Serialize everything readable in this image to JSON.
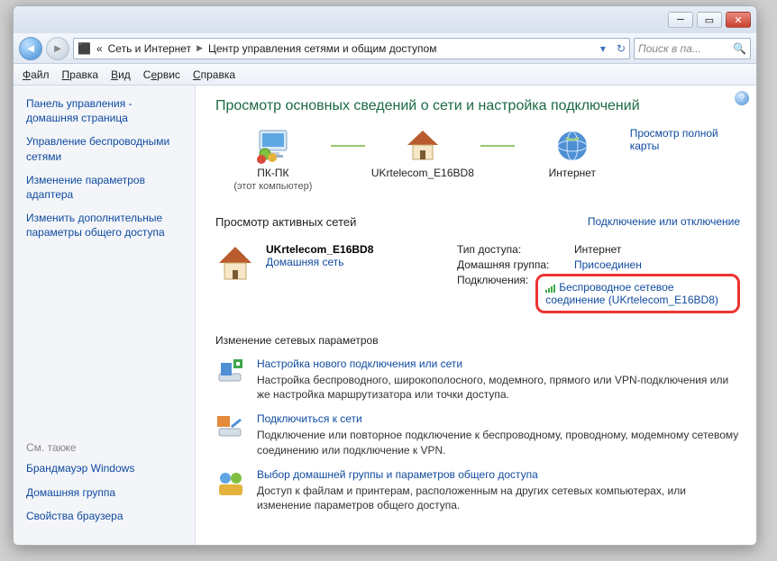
{
  "titlebar": {
    "min": "─",
    "max": "▭",
    "close": "✕"
  },
  "nav": {
    "addr_icon": "⧉",
    "path": [
      "Сеть и Интернет",
      "Центр управления сетями и общим доступом"
    ],
    "search_placeholder": "Поиск в па..."
  },
  "menu": {
    "file": "Файл",
    "edit": "Правка",
    "view": "Вид",
    "tools": "Сервис",
    "help": "Справка"
  },
  "sidebar": {
    "top": [
      "Панель управления - домашняя страница",
      "Управление беспроводными сетями",
      "Изменение параметров адаптера",
      "Изменить дополнительные параметры общего доступа"
    ],
    "bottom_heading": "См. также",
    "bottom": [
      "Брандмауэр Windows",
      "Домашняя группа",
      "Свойства браузера"
    ]
  },
  "content": {
    "heading": "Просмотр основных сведений о сети и настройка подключений",
    "map": {
      "node1": {
        "label": "ПК-ПК",
        "sub": "(этот компьютер)"
      },
      "node2": {
        "label": "UKrtelecom_E16BD8"
      },
      "node3": {
        "label": "Интернет"
      },
      "fullmap": "Просмотр полной карты"
    },
    "active_heading": "Просмотр активных сетей",
    "connect_link": "Подключение или отключение",
    "network": {
      "name": "UKrtelecom_E16BD8",
      "type_link": "Домашняя сеть",
      "rows": {
        "access_lbl": "Тип доступа:",
        "access_val": "Интернет",
        "home_lbl": "Домашняя группа:",
        "home_val": "Присоединен",
        "conn_lbl": "Подключения:",
        "conn_val": "Беспроводное сетевое соединение (UKrtelecom_E16BD8)"
      }
    },
    "change_heading": "Изменение сетевых параметров",
    "opts": [
      {
        "title": "Настройка нового подключения или сети",
        "desc": "Настройка беспроводного, широкополосного, модемного, прямого или VPN-подключения или же настройка маршрутизатора или точки доступа."
      },
      {
        "title": "Подключиться к сети",
        "desc": "Подключение или повторное подключение к беспроводному, проводному, модемному сетевому соединению или подключение к VPN."
      },
      {
        "title": "Выбор домашней группы и параметров общего доступа",
        "desc": "Доступ к файлам и принтерам, расположенным на других сетевых компьютерах, или изменение параметров общего доступа."
      }
    ]
  }
}
